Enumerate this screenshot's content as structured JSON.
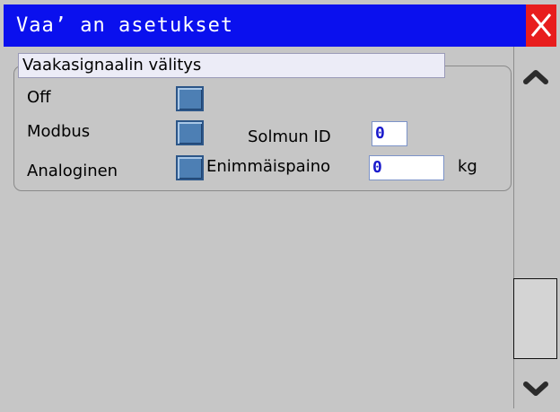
{
  "window": {
    "title": "Vaa’ an asetukset",
    "title_bg": "#0a10ee",
    "close_icon": "close-icon",
    "close_bg": "#e81d1d"
  },
  "group": {
    "title": "Vaakasignaalin välitys",
    "options": [
      {
        "label": "Off"
      },
      {
        "label": "Modbus"
      },
      {
        "label": "Analoginen"
      }
    ],
    "node_id": {
      "label": "Solmun ID",
      "value": "0"
    },
    "max_weight": {
      "label": "Enimmäispaino",
      "value": "0",
      "unit": "kg"
    }
  },
  "scrollbar": {
    "up_icon": "chevron-up-icon",
    "down_icon": "chevron-down-icon"
  }
}
